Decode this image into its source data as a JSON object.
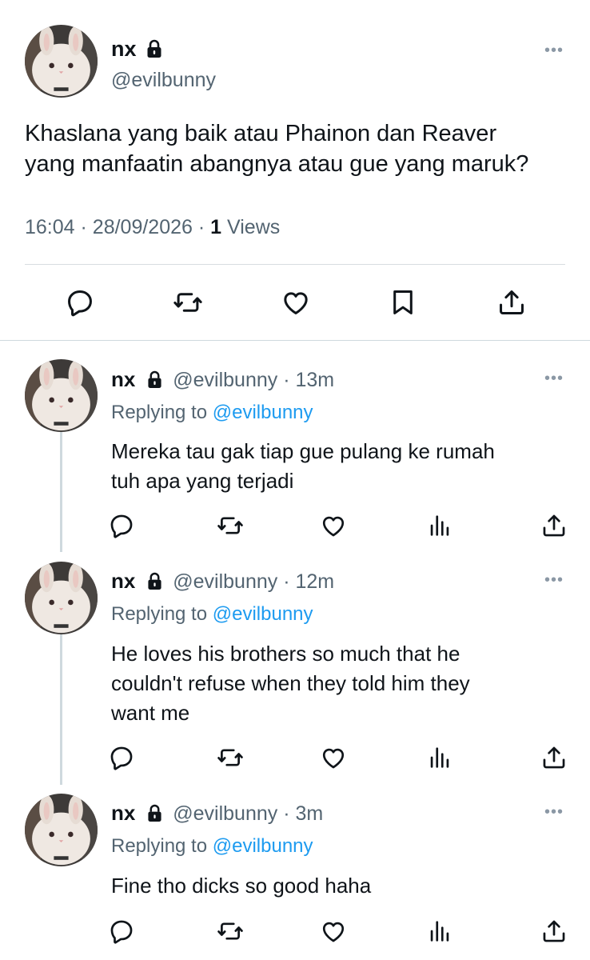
{
  "main_tweet": {
    "name": "nx",
    "handle": "@evilbunny",
    "text_line1": "Khaslana yang baik atau Phainon dan Reaver",
    "text_line2": "yang manfaatin abangnya atau gue yang maruk?",
    "time": "16:04",
    "date": "28/09/2026",
    "views_count": "1",
    "views_label": "Views",
    "actions": [
      "reply-icon",
      "retweet-icon",
      "like-icon",
      "bookmark-icon",
      "share-icon"
    ]
  },
  "replies": [
    {
      "name": "nx",
      "handle": "@evilbunny",
      "time": "13m",
      "replying_prefix": "Replying to",
      "replying_to": "@evilbunny",
      "lines": [
        "Mereka tau gak tiap gue pulang ke rumah",
        "tuh apa yang terjadi"
      ]
    },
    {
      "name": "nx",
      "handle": "@evilbunny",
      "time": "12m",
      "replying_prefix": "Replying to",
      "replying_to": "@evilbunny",
      "lines": [
        "He loves his brothers so much that he",
        "couldn't refuse when they told him they",
        "want me"
      ]
    },
    {
      "name": "nx",
      "handle": "@evilbunny",
      "time": "3m",
      "replying_prefix": "Replying to",
      "replying_to": "@evilbunny",
      "lines": [
        "Fine tho dicks so good haha"
      ]
    }
  ],
  "reply_actions": [
    "reply-icon",
    "retweet-icon",
    "like-icon",
    "views-icon",
    "share-icon"
  ],
  "colors": {
    "accent": "#1d9bf0",
    "muted": "#536471",
    "text": "#0f1419",
    "divider": "#cfd9de"
  }
}
